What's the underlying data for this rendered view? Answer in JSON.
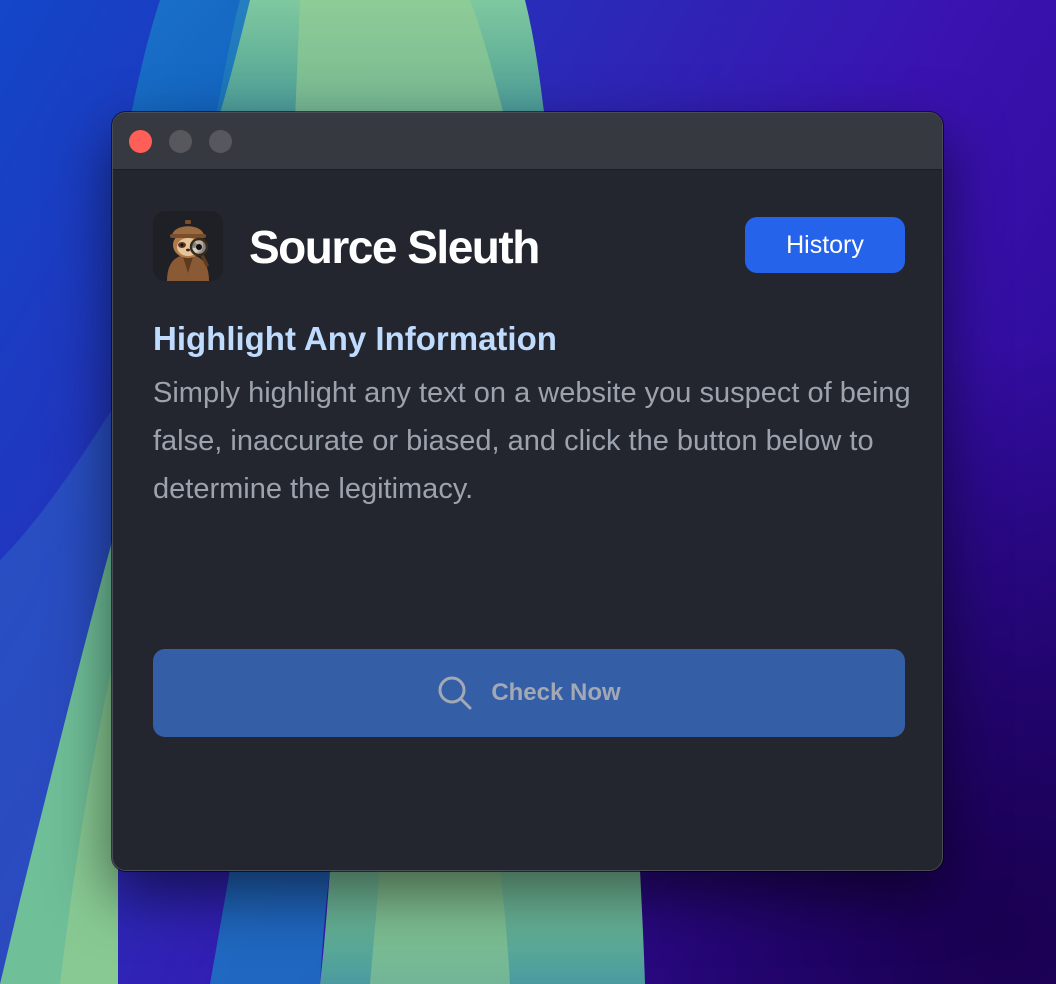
{
  "app": {
    "title": "Source Sleuth",
    "logo_icon": "sloth-detective-icon"
  },
  "header": {
    "history_label": "History"
  },
  "intro": {
    "heading": "Highlight Any Information",
    "description": "Simply highlight any text on a website you suspect of being false, inaccurate or biased, and click the button below to determine the legitimacy."
  },
  "actions": {
    "check_label": "Check Now",
    "check_icon": "search-icon"
  },
  "colors": {
    "accent": "#2563eb",
    "heading": "#bfdbfe",
    "window_bg": "#23262e",
    "close_button": "#ff5f57"
  }
}
